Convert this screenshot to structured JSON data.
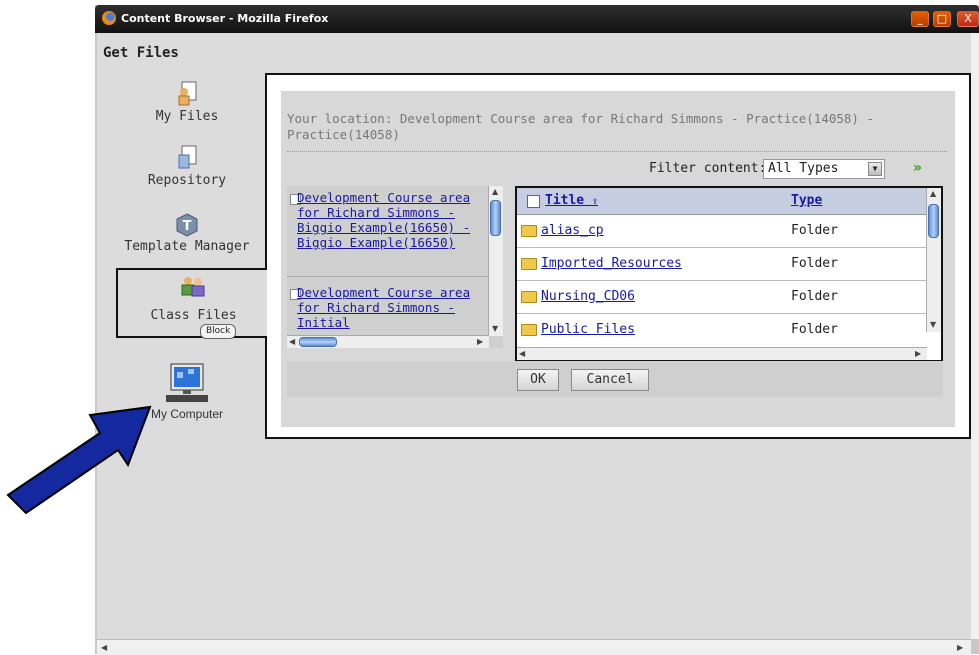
{
  "window": {
    "title": "Content Browser - Mozilla Firefox",
    "controls": [
      "_",
      "□",
      "X"
    ]
  },
  "header": {
    "title": "Get Files"
  },
  "sidebar": {
    "items": [
      {
        "label": "My Files",
        "icon": "person-file-icon"
      },
      {
        "label": "Repository",
        "icon": "repository-file-icon"
      },
      {
        "label": "Template Manager",
        "icon": "template-t-icon"
      },
      {
        "label": "Class Files",
        "icon": "class-people-icon",
        "badge": "Block",
        "selected": true
      },
      {
        "label": "My Computer",
        "icon": "computer-icon"
      }
    ]
  },
  "location": {
    "text": "Your location: Development Course area for Richard Simmons - Practice(14058) - Practice(14058)"
  },
  "filter": {
    "label": "Filter content:",
    "value": "All Types"
  },
  "tree": {
    "items": [
      {
        "label": "Development Course area for Richard Simmons - Biggio Example(16650) - Biggio Example(16650)"
      },
      {
        "label": "Development Course area for Richard Simmons - Initial"
      }
    ]
  },
  "grid": {
    "columns": {
      "title": "Title",
      "type": "Type"
    },
    "rows": [
      {
        "name": "alias_cp",
        "type": "Folder"
      },
      {
        "name": "Imported_Resources",
        "type": "Folder"
      },
      {
        "name": "Nursing_CD06",
        "type": "Folder"
      },
      {
        "name": "Public Files",
        "type": "Folder"
      }
    ]
  },
  "buttons": {
    "ok": "OK",
    "cancel": "Cancel"
  },
  "colors": {
    "arrow": "#1428a0",
    "link": "#1a1aa0"
  }
}
